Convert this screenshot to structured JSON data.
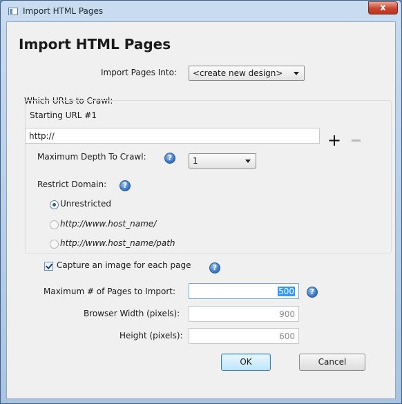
{
  "window": {
    "title": "Import HTML Pages",
    "close_glyph": "x"
  },
  "heading": "Import HTML Pages",
  "import_into": {
    "label": "Import Pages Into:",
    "value": "<create new design>"
  },
  "urls_group": {
    "label": "Which URLs to Crawl:",
    "starting_url_label": "Starting URL #1",
    "url_value": "http://",
    "add_glyph": "+",
    "depth": {
      "label": "Maximum Depth To Crawl:",
      "value": "1"
    },
    "restrict": {
      "label": "Restrict Domain:",
      "options": [
        "Unrestricted",
        "http://www.host_name/",
        "http://www.host_name/path"
      ],
      "selected": "Unrestricted"
    }
  },
  "capture": {
    "label": "Capture an image for each page",
    "checked": true
  },
  "max_pages": {
    "label": "Maximum # of Pages to Import:",
    "value": "500"
  },
  "browser_width": {
    "label": "Browser Width (pixels):",
    "value": "900"
  },
  "browser_height": {
    "label": "Height (pixels):",
    "value": "600"
  },
  "buttons": {
    "ok": "OK",
    "cancel": "Cancel"
  },
  "help_glyph": "?"
}
